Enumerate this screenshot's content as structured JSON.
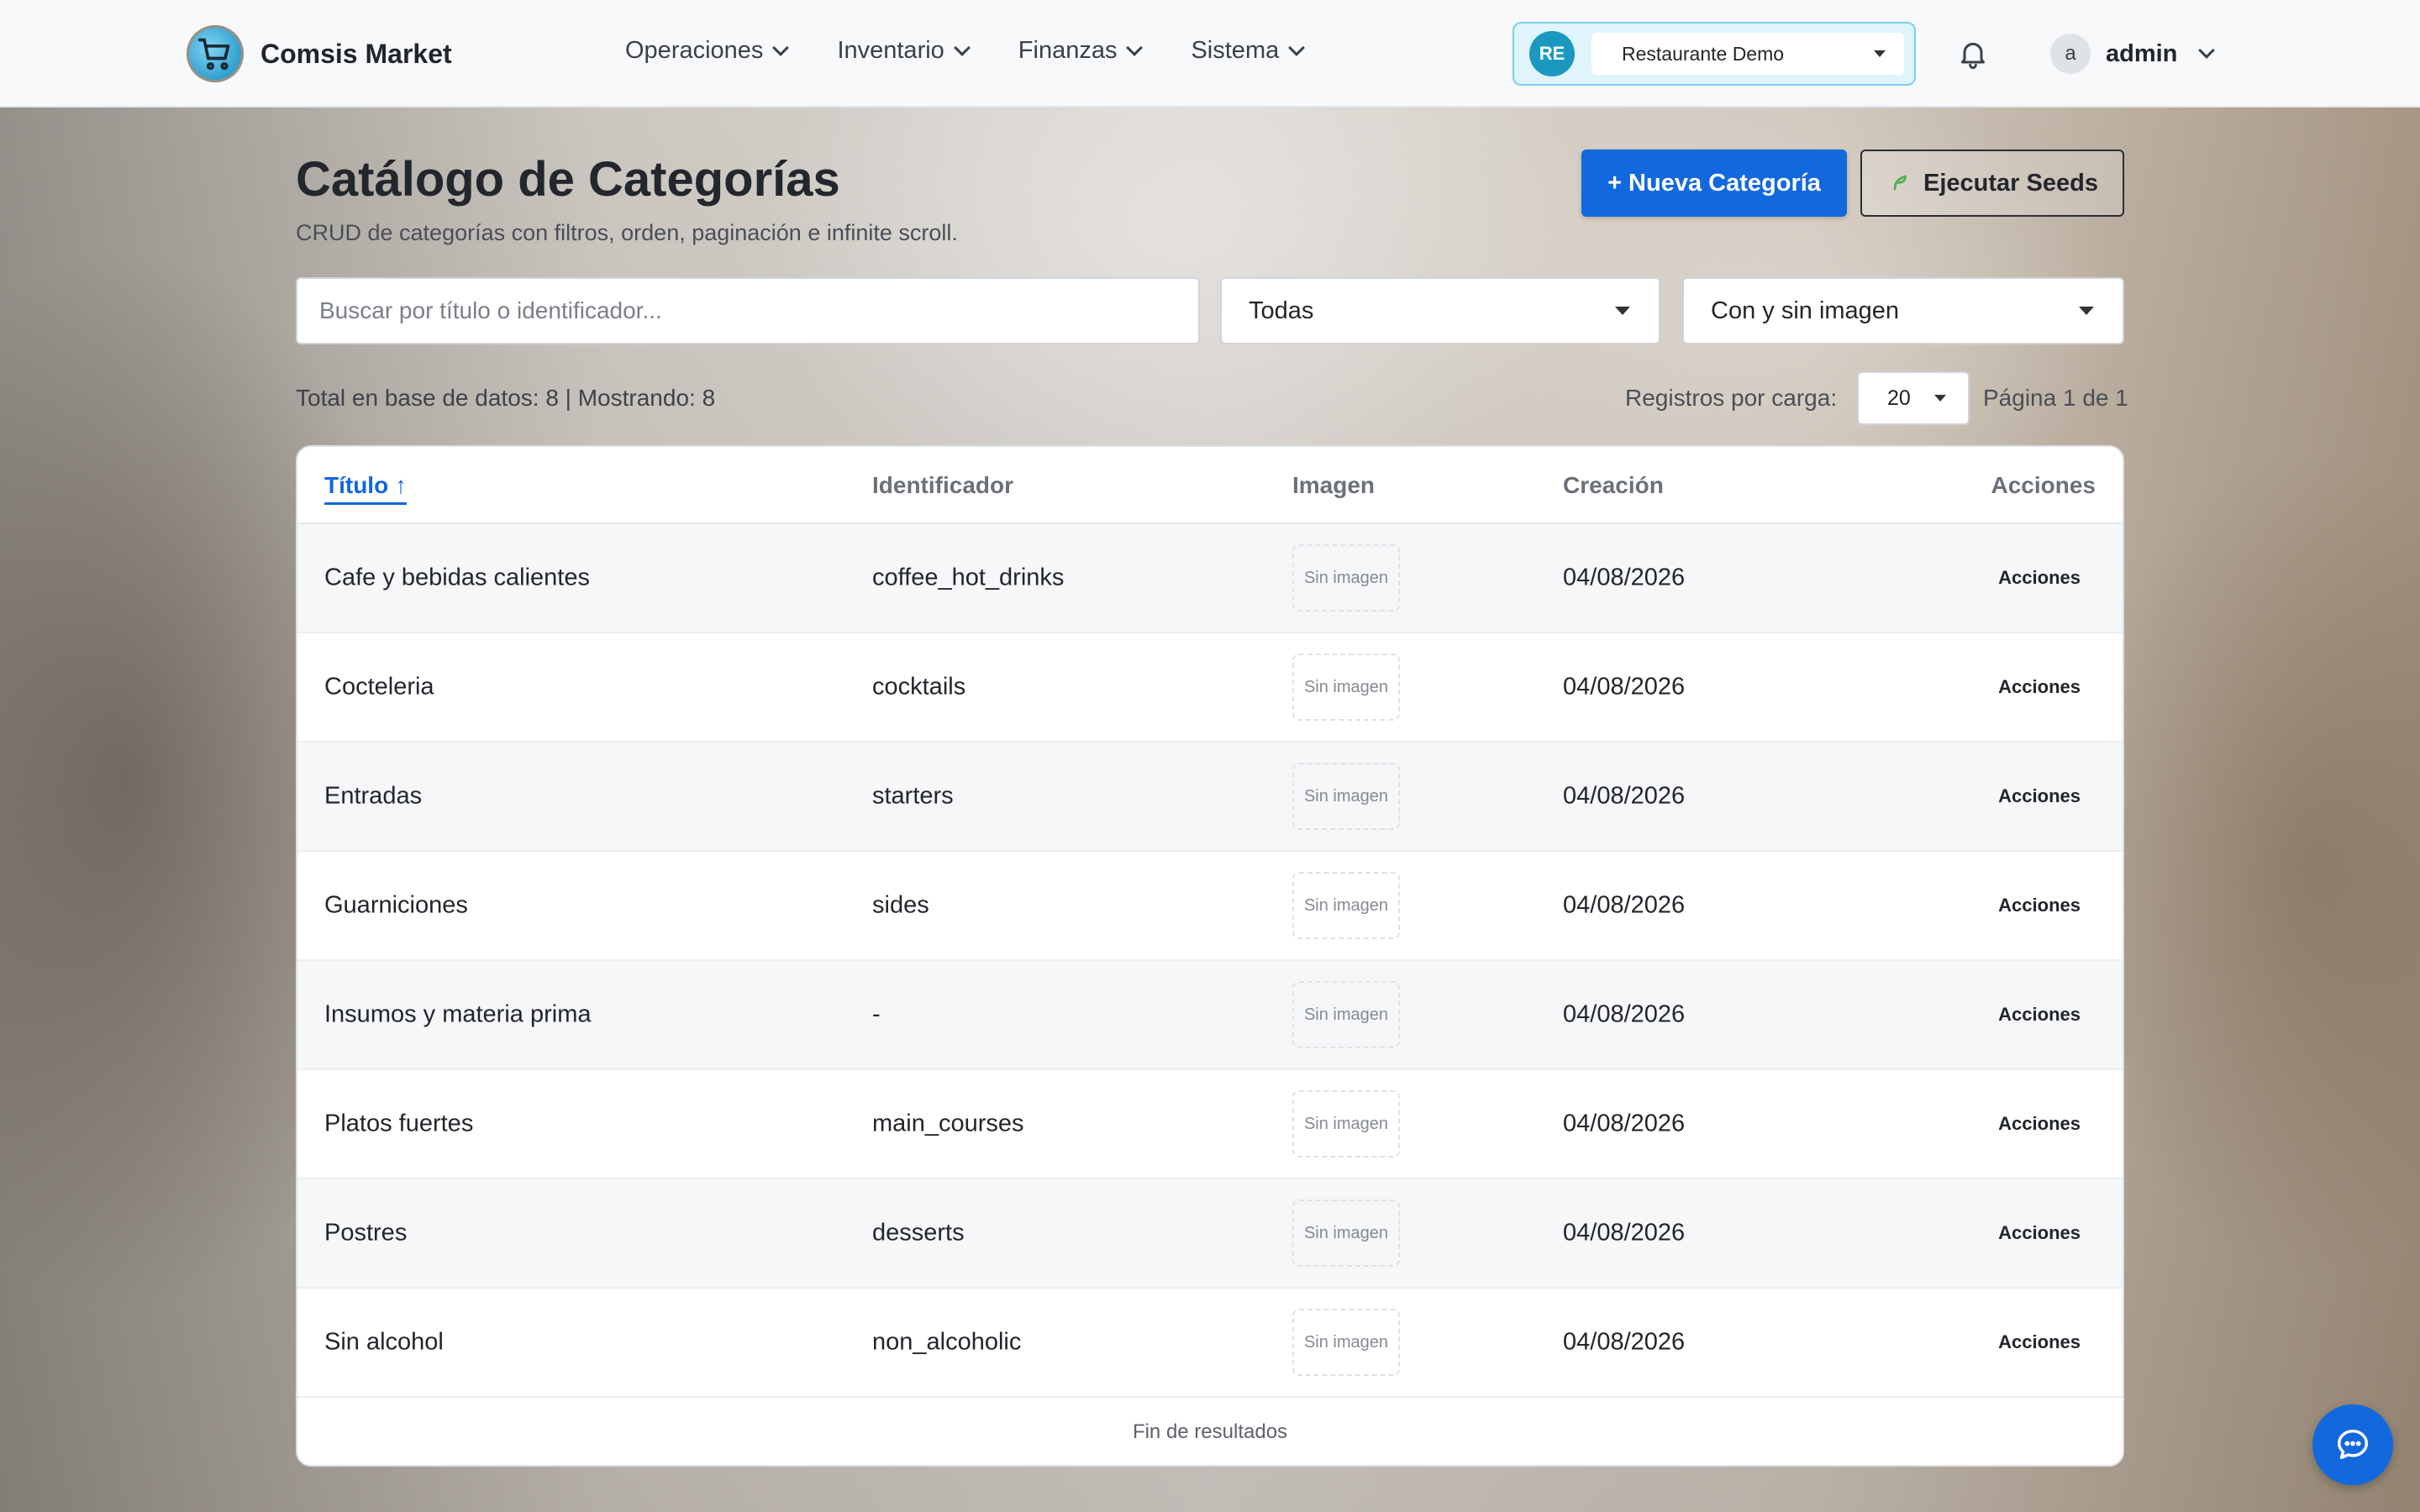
{
  "brand": {
    "name": "Comsis Market",
    "logo_icon": "shopping-cart-icon"
  },
  "nav": {
    "items": [
      {
        "label": "Operaciones"
      },
      {
        "label": "Inventario"
      },
      {
        "label": "Finanzas"
      },
      {
        "label": "Sistema"
      }
    ]
  },
  "tenant": {
    "badge": "RE",
    "name": "Restaurante Demo"
  },
  "user": {
    "initial": "a",
    "name": "admin"
  },
  "header": {
    "title": "Catálogo de Categorías",
    "subtitle": "CRUD de categorías con filtros, orden, paginación e infinite scroll.",
    "new_button": "+ Nueva Categoría",
    "seeds_button": "Ejecutar Seeds"
  },
  "filters": {
    "search_placeholder": "Buscar por título o identificador...",
    "status_value": "Todas",
    "image_value": "Con y sin imagen"
  },
  "summary": {
    "totals": "Total en base de datos: 8 | Mostrando: 8",
    "per_load_label": "Registros por carga:",
    "per_load_value": "20",
    "page_info": "Página 1 de 1"
  },
  "table": {
    "columns": {
      "title": "Título ↑",
      "identifier": "Identificador",
      "image": "Imagen",
      "created": "Creación",
      "actions": "Acciones"
    },
    "rows": [
      {
        "title": "Cafe y bebidas calientes",
        "identifier": "coffee_hot_drinks",
        "image": "Sin imagen",
        "created": "04/08/2026",
        "actions": "Acciones"
      },
      {
        "title": "Cocteleria",
        "identifier": "cocktails",
        "image": "Sin imagen",
        "created": "04/08/2026",
        "actions": "Acciones"
      },
      {
        "title": "Entradas",
        "identifier": "starters",
        "image": "Sin imagen",
        "created": "04/08/2026",
        "actions": "Acciones"
      },
      {
        "title": "Guarniciones",
        "identifier": "sides",
        "image": "Sin imagen",
        "created": "04/08/2026",
        "actions": "Acciones"
      },
      {
        "title": "Insumos y materia prima",
        "identifier": "-",
        "image": "Sin imagen",
        "created": "04/08/2026",
        "actions": "Acciones"
      },
      {
        "title": "Platos fuertes",
        "identifier": "main_courses",
        "image": "Sin imagen",
        "created": "04/08/2026",
        "actions": "Acciones"
      },
      {
        "title": "Postres",
        "identifier": "desserts",
        "image": "Sin imagen",
        "created": "04/08/2026",
        "actions": "Acciones"
      },
      {
        "title": "Sin alcohol",
        "identifier": "non_alcoholic",
        "image": "Sin imagen",
        "created": "04/08/2026",
        "actions": "Acciones"
      }
    ],
    "footer": "Fin de resultados"
  },
  "colors": {
    "primary": "#1268dd",
    "tenant_badge": "#1b98c0",
    "tenant_bg": "#dff4fb"
  }
}
